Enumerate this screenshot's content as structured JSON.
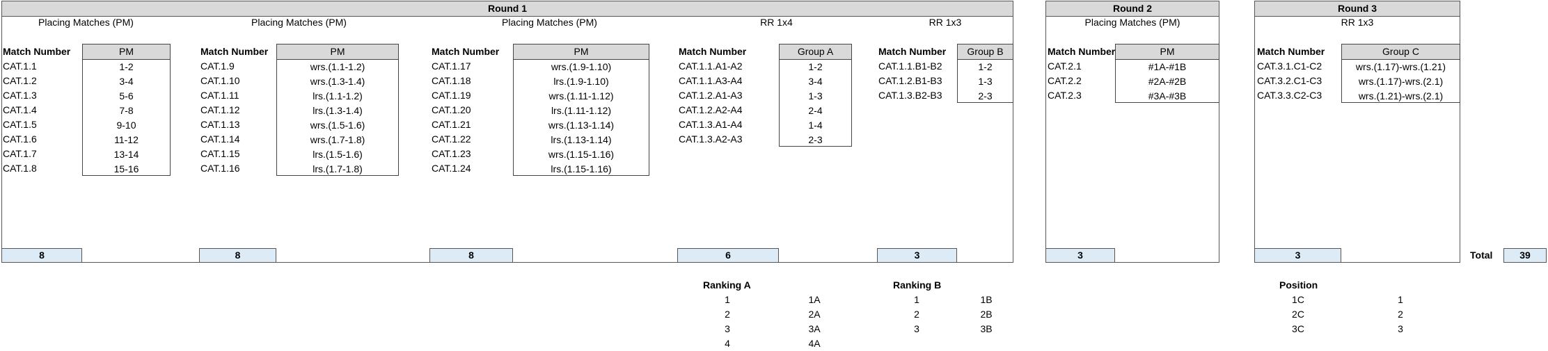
{
  "rounds": [
    {
      "title": "Round 1"
    },
    {
      "title": "Round 2"
    },
    {
      "title": "Round 3"
    }
  ],
  "sections": [
    {
      "title": "Placing Matches (PM)",
      "col_match": "Match Number",
      "col_group": "PM",
      "matches": [
        "CAT.1.1",
        "CAT.1.2",
        "CAT.1.3",
        "CAT.1.4",
        "CAT.1.5",
        "CAT.1.6",
        "CAT.1.7",
        "CAT.1.8"
      ],
      "values": [
        "1-2",
        "3-4",
        "5-6",
        "7-8",
        "9-10",
        "11-12",
        "13-14",
        "15-16"
      ],
      "count": "8"
    },
    {
      "title": "Placing Matches (PM)",
      "col_match": "Match Number",
      "col_group": "PM",
      "matches": [
        "CAT.1.9",
        "CAT.1.10",
        "CAT.1.11",
        "CAT.1.12",
        "CAT.1.13",
        "CAT.1.14",
        "CAT.1.15",
        "CAT.1.16"
      ],
      "values": [
        "wrs.(1.1-1.2)",
        "wrs.(1.3-1.4)",
        "lrs.(1.1-1.2)",
        "lrs.(1.3-1.4)",
        "wrs.(1.5-1.6)",
        "wrs.(1.7-1.8)",
        "lrs.(1.5-1.6)",
        "lrs.(1.7-1.8)"
      ],
      "count": "8"
    },
    {
      "title": "Placing Matches (PM)",
      "col_match": "Match Number",
      "col_group": "PM",
      "matches": [
        "CAT.1.17",
        "CAT.1.18",
        "CAT.1.19",
        "CAT.1.20",
        "CAT.1.21",
        "CAT.1.22",
        "CAT.1.23",
        "CAT.1.24"
      ],
      "values": [
        "wrs.(1.9-1.10)",
        "lrs.(1.9-1.10)",
        "wrs.(1.11-1.12)",
        "lrs.(1.11-1.12)",
        "wrs.(1.13-1.14)",
        "lrs.(1.13-1.14)",
        "wrs.(1.15-1.16)",
        "lrs.(1.15-1.16)"
      ],
      "count": "8"
    },
    {
      "title": "RR 1x4",
      "col_match": "Match Number",
      "col_group": "Group A",
      "matches": [
        "CAT.1.1.A1-A2",
        "CAT.1.1.A3-A4",
        "CAT.1.2.A1-A3",
        "CAT.1.2.A2-A4",
        "CAT.1.3.A1-A4",
        "CAT.1.3.A2-A3"
      ],
      "values": [
        "1-2",
        "3-4",
        "1-3",
        "2-4",
        "1-4",
        "2-3"
      ],
      "count": "6"
    },
    {
      "title": "RR 1x3",
      "col_match": "Match Number",
      "col_group": "Group B",
      "matches": [
        "CAT.1.1.B1-B2",
        "CAT.1.2.B1-B3",
        "CAT.1.3.B2-B3"
      ],
      "values": [
        "1-2",
        "1-3",
        "2-3"
      ],
      "count": "3"
    },
    {
      "title": "Placing Matches (PM)",
      "col_match": "Match Number",
      "col_group": "PM",
      "matches": [
        "CAT.2.1",
        "CAT.2.2",
        "CAT.2.3"
      ],
      "values": [
        "#1A-#1B",
        "#2A-#2B",
        "#3A-#3B"
      ],
      "count": "3"
    },
    {
      "title": "RR 1x3",
      "col_match": "Match Number",
      "col_group": "Group C",
      "matches": [
        "CAT.3.1.C1-C2",
        "CAT.3.2.C1-C3",
        "CAT.3.3.C2-C3"
      ],
      "values": [
        "wrs.(1.17)-wrs.(1.21)",
        "wrs.(1.17)-wrs.(2.1)",
        "wrs.(1.21)-wrs.(2.1)"
      ],
      "count": "3"
    }
  ],
  "total": {
    "label": "Total",
    "value": "39"
  },
  "rankings": [
    {
      "title": "Ranking A",
      "ranks": [
        "1",
        "2",
        "3",
        "4"
      ],
      "values": [
        "1A",
        "2A",
        "3A",
        "4A"
      ]
    },
    {
      "title": "Ranking B",
      "ranks": [
        "1",
        "2",
        "3"
      ],
      "values": [
        "1B",
        "2B",
        "3B"
      ]
    },
    {
      "title": "Position",
      "ranks": [
        "1C",
        "2C",
        "3C"
      ],
      "values": [
        "1",
        "2",
        "3"
      ]
    }
  ]
}
